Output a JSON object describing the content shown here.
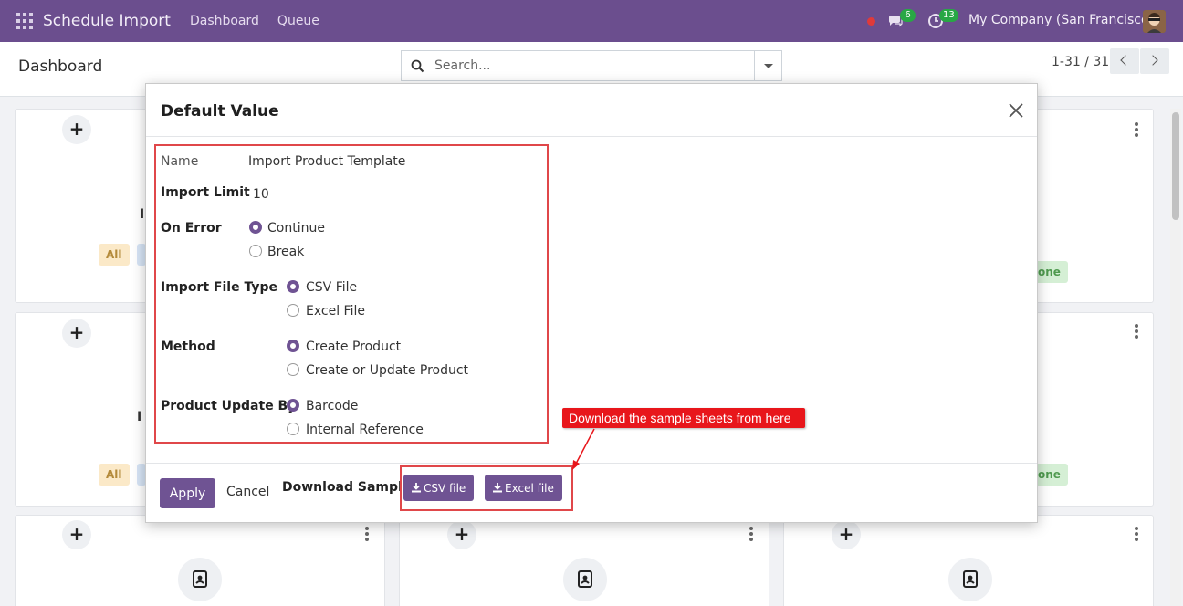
{
  "navbar": {
    "app_title": "Schedule Import",
    "menu": [
      "Dashboard",
      "Queue"
    ],
    "messages_count": "6",
    "activities_count": "13",
    "company": "My Company (San Francisco)"
  },
  "control": {
    "breadcrumb": "Dashboard",
    "search_placeholder": "Search...",
    "pager": "1-31 / 31"
  },
  "cards": {
    "tag_all": "All",
    "tag_done": "one",
    "partial_text": "I"
  },
  "modal": {
    "title": "Default Value",
    "fields": {
      "name_label": "Name",
      "name_value": "Import Product Template",
      "import_limit_label": "Import Limit",
      "import_limit_value": "10",
      "on_error_label": "On Error",
      "on_error_options": [
        "Continue",
        "Break"
      ],
      "file_type_label": "Import File Type",
      "file_type_options": [
        "CSV File",
        "Excel File"
      ],
      "method_label": "Method",
      "method_options": [
        "Create Product",
        "Create or Update Product"
      ],
      "update_by_label": "Product Update By",
      "update_by_options": [
        "Barcode",
        "Internal Reference"
      ]
    },
    "footer": {
      "apply": "Apply",
      "cancel": "Cancel",
      "download_label": "Download Sample:",
      "csv_button": "CSV file",
      "excel_button": "Excel file"
    }
  },
  "annotation": {
    "callout": "Download the sample sheets from here",
    "color": "#e8161b"
  },
  "colors": {
    "navbar": "#6b4e8e",
    "primary": "#6f5393",
    "highlight": "#e0474a"
  }
}
